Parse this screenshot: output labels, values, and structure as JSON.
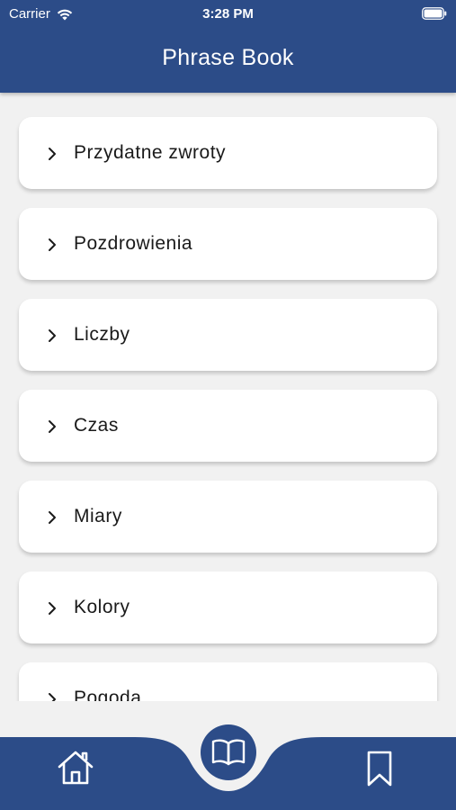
{
  "status_bar": {
    "carrier": "Carrier",
    "time": "3:28 PM"
  },
  "header": {
    "title": "Phrase Book"
  },
  "categories": [
    {
      "label": "Przydatne zwroty"
    },
    {
      "label": "Pozdrowienia"
    },
    {
      "label": "Liczby"
    },
    {
      "label": "Czas"
    },
    {
      "label": "Miary"
    },
    {
      "label": "Kolory"
    },
    {
      "label": "Pogoda"
    }
  ],
  "tabbar": {
    "items": [
      {
        "icon": "home-icon"
      },
      {
        "icon": "book-icon",
        "active": true
      },
      {
        "icon": "bookmark-icon"
      }
    ]
  },
  "colors": {
    "primary": "#2c4c88",
    "background": "#f1f1f1",
    "card": "#ffffff"
  }
}
